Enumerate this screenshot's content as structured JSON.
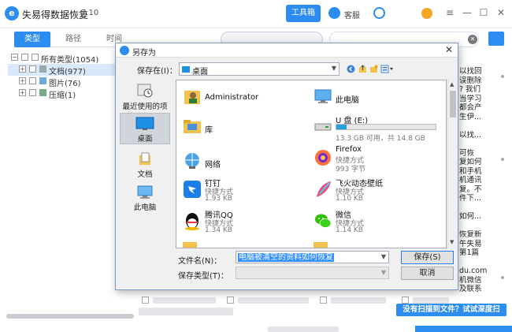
{
  "app": {
    "title": "失易得数据恢复",
    "version": "7.10",
    "toolbox_label": "工具箱",
    "support_label": "客服",
    "logo_letter": "e"
  },
  "left_tabs": [
    "类型",
    "路径",
    "时间"
  ],
  "tree": [
    {
      "label": "所有类型(1054)",
      "level": 0
    },
    {
      "label": "文档(977)",
      "level": 1
    },
    {
      "label": "图片(76)",
      "level": 1
    },
    {
      "label": "压缩(1)",
      "level": 1
    }
  ],
  "right_panel_lines": [
    "以找回",
    "误删除",
    "? 我们",
    "当学习",
    "都会产",
    "生伊...",
    "",
    "以找...",
    "",
    "可恢",
    "复如何",
    "和手机",
    "机通讯",
    "复。不",
    "件下...",
    "",
    "如何...",
    "",
    "恢复新",
    "午失易",
    "第1篇",
    "",
    "du.com",
    "机微信",
    "及联系"
  ],
  "deep_scan_label": "没有扫描到文件？试试深度扫描！",
  "dialog": {
    "title": "另存为",
    "save_in_label": "保存在(I)：",
    "save_in_value": "桌面",
    "places": [
      "最近使用的项目",
      "桌面",
      "文档",
      "此电脑"
    ],
    "files": [
      {
        "name": "Administrator",
        "sub1": "",
        "sub2": "",
        "icon": "user-folder"
      },
      {
        "name": "此电脑",
        "sub1": "",
        "sub2": "",
        "icon": "computer"
      },
      {
        "name": "库",
        "sub1": "",
        "sub2": "",
        "icon": "folder"
      },
      {
        "name": "U 盘 (E:)",
        "sub1": "13.3 GB 可用，共 14.8 GB",
        "sub2": "",
        "icon": "usb-drive",
        "usage": 0.1
      },
      {
        "name": "网络",
        "sub1": "",
        "sub2": "",
        "icon": "network"
      },
      {
        "name": "Firefox",
        "sub1": "快捷方式",
        "sub2": "993 字节",
        "icon": "firefox"
      },
      {
        "name": "钉钉",
        "sub1": "快捷方式",
        "sub2": "1.93 KB",
        "icon": "dingtalk"
      },
      {
        "name": "飞火动态壁纸",
        "sub1": "快捷方式",
        "sub2": "1.10 KB",
        "icon": "feather"
      },
      {
        "name": "腾讯QQ",
        "sub1": "快捷方式",
        "sub2": "1.34 KB",
        "icon": "qq"
      },
      {
        "name": "微信",
        "sub1": "快捷方式",
        "sub2": "1.14 KB",
        "icon": "wechat"
      }
    ],
    "filename_label": "文件名(N)：",
    "filename_value": "电脑被清空的资料如何恢复",
    "filetype_label": "保存类型(T)：",
    "save_button": "保存(S)",
    "cancel_button": "取消"
  },
  "colors": {
    "accent": "#2d8cf0",
    "selection": "#3390ff"
  }
}
